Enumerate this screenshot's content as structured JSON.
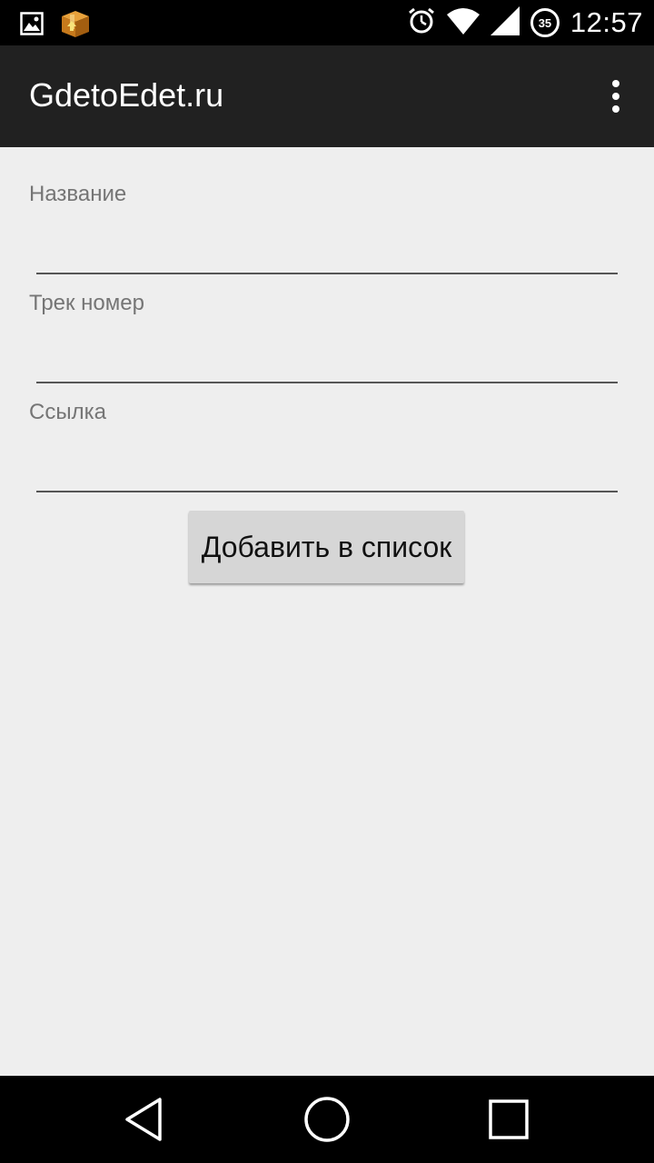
{
  "status_bar": {
    "time": "12:57",
    "battery_level": "35",
    "left_icons": [
      "image-icon",
      "package-icon"
    ],
    "right_icons": [
      "alarm-icon",
      "wifi-icon",
      "signal-icon",
      "battery-icon"
    ]
  },
  "app_bar": {
    "title": "GdetoEdet.ru",
    "overflow_icon": "more-vert-icon"
  },
  "form": {
    "name_label": "Название",
    "name_value": "",
    "track_label": "Трек номер",
    "track_value": "",
    "link_label": "Ссылка",
    "link_value": "",
    "add_button_label": "Добавить в список"
  },
  "nav_bar": {
    "icons": [
      "back-icon",
      "home-icon",
      "recents-icon"
    ]
  },
  "colors": {
    "app_bar": "#212121",
    "background": "#eeeeee",
    "status_bar": "#000000",
    "button": "#d6d6d6"
  }
}
